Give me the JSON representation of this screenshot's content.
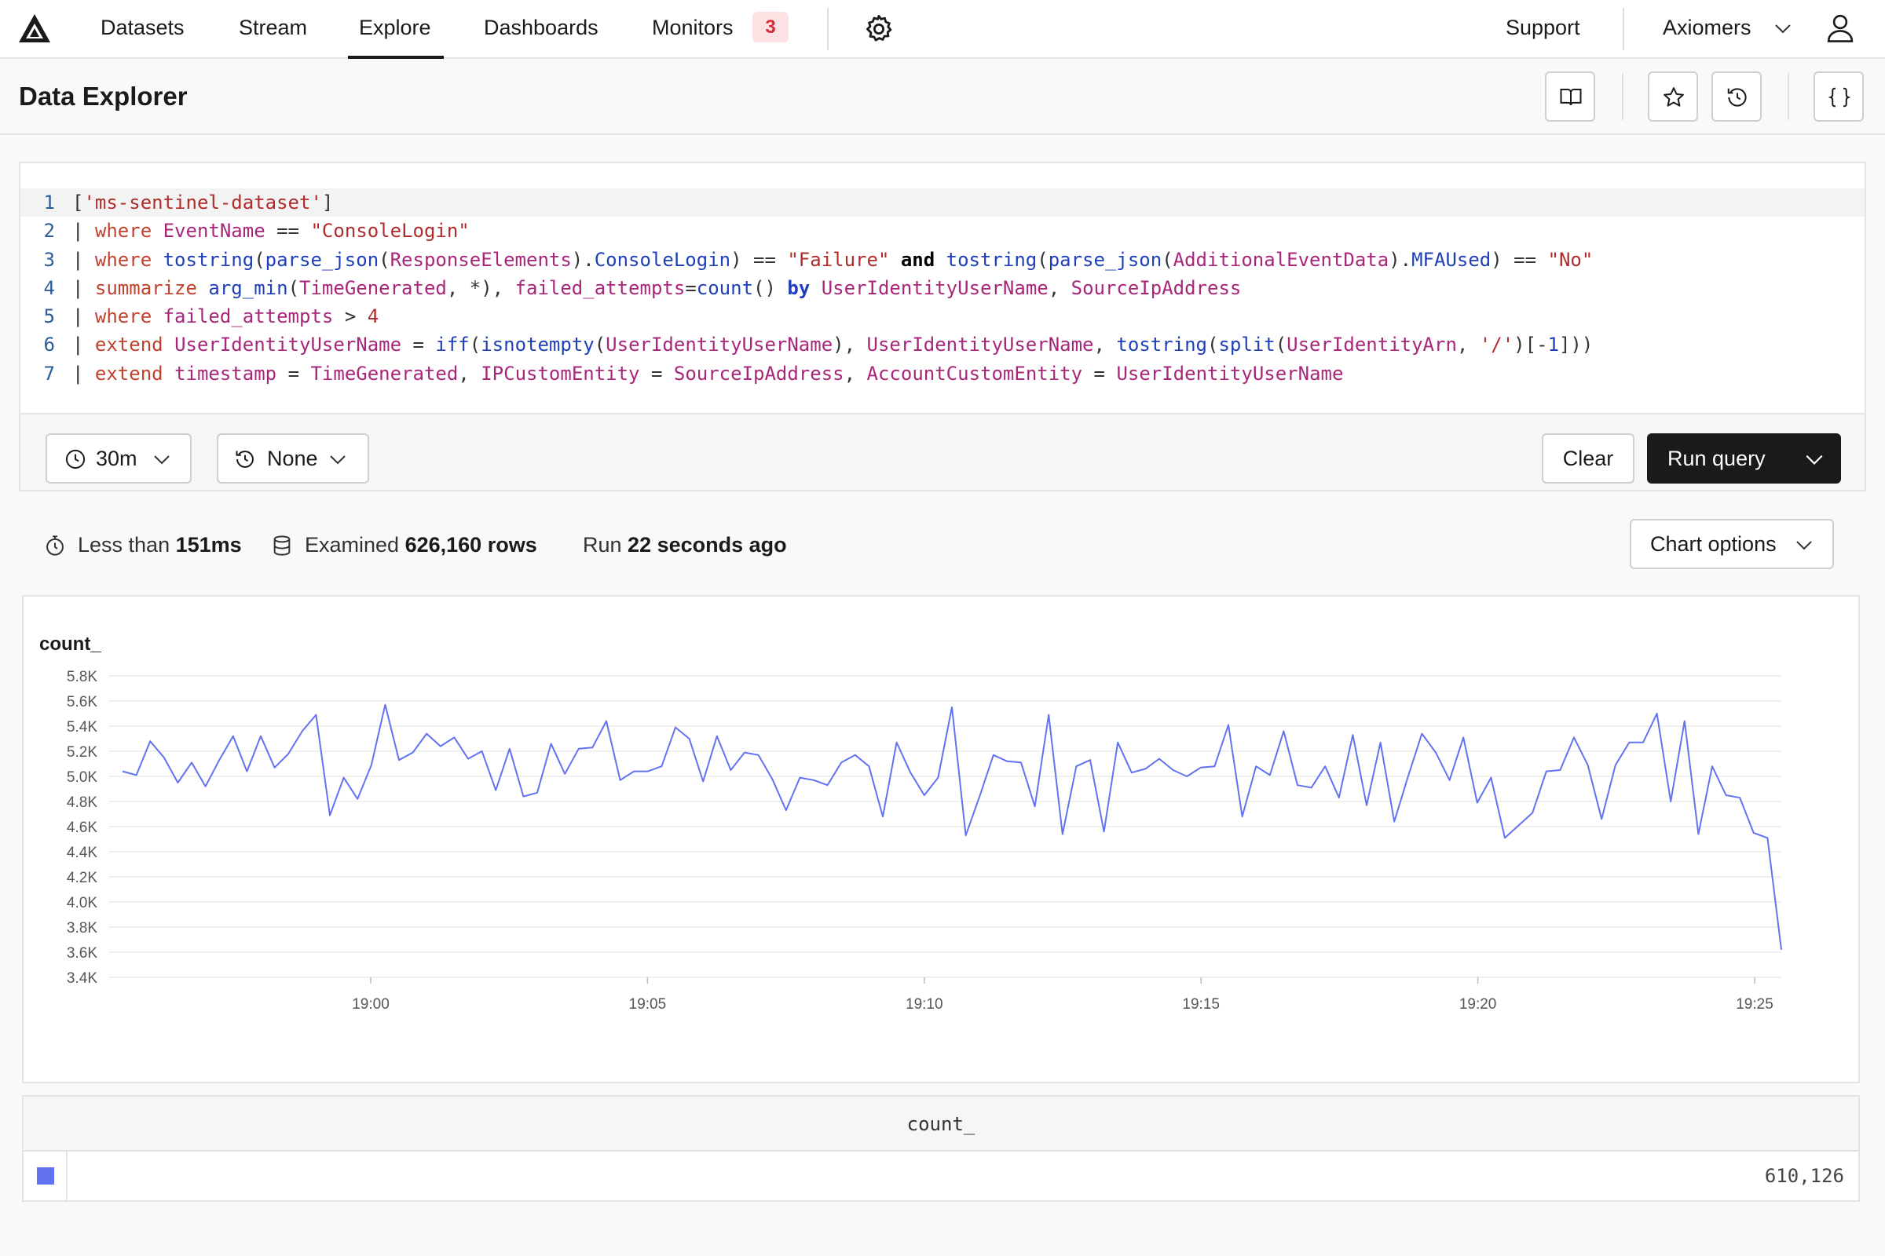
{
  "nav": {
    "items": [
      {
        "label": "Datasets"
      },
      {
        "label": "Stream"
      },
      {
        "label": "Explore",
        "active": true
      },
      {
        "label": "Dashboards"
      },
      {
        "label": "Monitors",
        "badge": "3"
      }
    ],
    "support": "Support",
    "org": "Axiomers",
    "icons": [
      "axiom-logo-icon",
      "gear-icon",
      "chevron-down-icon",
      "user-icon"
    ]
  },
  "header": {
    "title": "Data Explorer",
    "buttons": [
      "book-icon",
      "star-icon",
      "history-icon",
      "braces-icon"
    ]
  },
  "editor": {
    "line_numbers": [
      "1",
      "2",
      "3",
      "4",
      "5",
      "6",
      "7"
    ],
    "lines": [
      "['ms-sentinel-dataset']",
      "| where EventName == \"ConsoleLogin\"",
      "| where tostring(parse_json(ResponseElements).ConsoleLogin) == \"Failure\" and tostring(parse_json(AdditionalEventData).MFAUsed) == \"No\"",
      "| summarize arg_min(TimeGenerated, *), failed_attempts=count() by UserIdentityUserName, SourceIpAddress",
      "| where failed_attempts > 4",
      "| extend UserIdentityUserName = iff(isnotempty(UserIdentityUserName), UserIdentityUserName, tostring(split(UserIdentityArn, '/')[-1]))",
      "| extend timestamp = TimeGenerated, IPCustomEntity = SourceIpAddress, AccountCustomEntity = UserIdentityUserName"
    ],
    "time_range": "30m",
    "compare": "None",
    "clear_label": "Clear",
    "run_label": "Run query"
  },
  "stats": {
    "duration_prefix": "Less than",
    "duration": "151ms",
    "examined_prefix": "Examined",
    "examined": "626,160 rows",
    "run_prefix": "Run",
    "run_ago": "22 seconds ago",
    "chart_options": "Chart options"
  },
  "chart_data": {
    "type": "line",
    "title": "count_",
    "series": [
      {
        "name": "count_",
        "color": "#6272f1",
        "values": [
          5040,
          5010,
          5280,
          5150,
          4950,
          5110,
          4920,
          5130,
          5320,
          5040,
          5320,
          5070,
          5180,
          5360,
          5490,
          4690,
          4990,
          4820,
          5090,
          5570,
          5130,
          5190,
          5340,
          5240,
          5310,
          5140,
          5200,
          4890,
          5220,
          4840,
          4870,
          5260,
          5020,
          5220,
          5230,
          5440,
          4970,
          5040,
          5040,
          5080,
          5390,
          5300,
          4960,
          5320,
          5050,
          5190,
          5170,
          4980,
          4730,
          4990,
          4970,
          4930,
          5110,
          5170,
          5080,
          4680,
          5270,
          5030,
          4850,
          4990,
          5550,
          4530,
          4840,
          5170,
          5120,
          5110,
          4760,
          5490,
          4540,
          5080,
          5130,
          4560,
          5270,
          5030,
          5060,
          5140,
          5050,
          5000,
          5070,
          5080,
          5410,
          4680,
          5080,
          5010,
          5360,
          4930,
          4910,
          5080,
          4830,
          5330,
          4770,
          5270,
          4640,
          5000,
          5340,
          5190,
          4970,
          5310,
          4790,
          4990,
          4510,
          4610,
          4710,
          5040,
          5050,
          5310,
          5090,
          4660,
          5090,
          5270,
          5270,
          5500,
          4800,
          5440,
          4540,
          5080,
          4850,
          4830,
          4550,
          4510,
          3620
        ]
      }
    ],
    "ylim": [
      3400,
      5800
    ],
    "yticks": [
      "5.8K",
      "5.6K",
      "5.4K",
      "5.2K",
      "5.0K",
      "4.8K",
      "4.6K",
      "4.4K",
      "4.2K",
      "4.0K",
      "3.8K",
      "3.6K",
      "3.4K"
    ],
    "xticks": [
      "19:00",
      "19:05",
      "19:10",
      "19:15",
      "19:20",
      "19:25"
    ],
    "grid": true
  },
  "table": {
    "header": "count_",
    "value": "610,126",
    "swatch_color": "#6272f1"
  }
}
